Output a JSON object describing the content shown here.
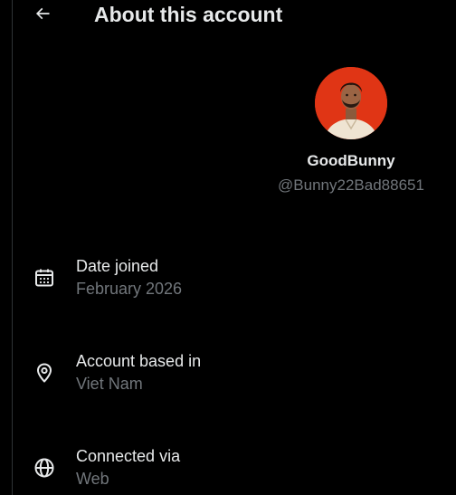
{
  "header": {
    "title": "About this account",
    "back_icon": "arrow-left-icon"
  },
  "profile": {
    "display_name": "GoodBunny",
    "handle": "@Bunny22Bad88651",
    "avatar_bg": "#e03515"
  },
  "info": [
    {
      "icon": "calendar-icon",
      "label": "Date joined",
      "value": "February 2026"
    },
    {
      "icon": "location-pin-icon",
      "label": "Account based in",
      "value": "Viet Nam"
    },
    {
      "icon": "globe-icon",
      "label": "Connected via",
      "value": "Web"
    }
  ],
  "colors": {
    "background": "#000000",
    "primary_text": "#e7e9ea",
    "secondary_text": "#71767b",
    "border": "#2f3336"
  }
}
